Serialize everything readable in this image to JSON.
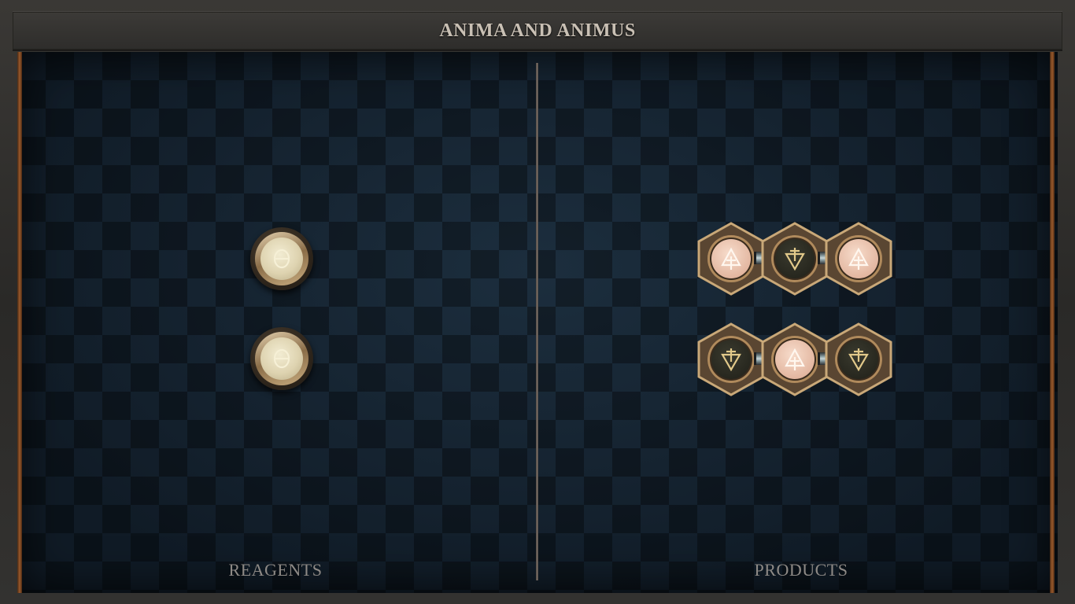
{
  "title": "ANIMA AND ANIMUS",
  "panels": {
    "reagents_label": "REAGENTS",
    "products_label": "PRODUCTS"
  },
  "reagents": [
    {
      "element": "salt",
      "symbol": "salt-icon"
    },
    {
      "element": "salt",
      "symbol": "salt-icon"
    }
  ],
  "products": [
    {
      "atoms": [
        "fire",
        "water",
        "fire"
      ],
      "bonds": 2
    },
    {
      "atoms": [
        "water",
        "fire",
        "water"
      ],
      "bonds": 2
    }
  ],
  "colors": {
    "board": "#13202c",
    "frame": "#2b2a28",
    "title_text": "#c9c0b4",
    "label_text": "#8e8a86",
    "fire_atom": "#e3b7a1",
    "water_atom": "#24241c",
    "salt_atom": "#ded3b0"
  }
}
